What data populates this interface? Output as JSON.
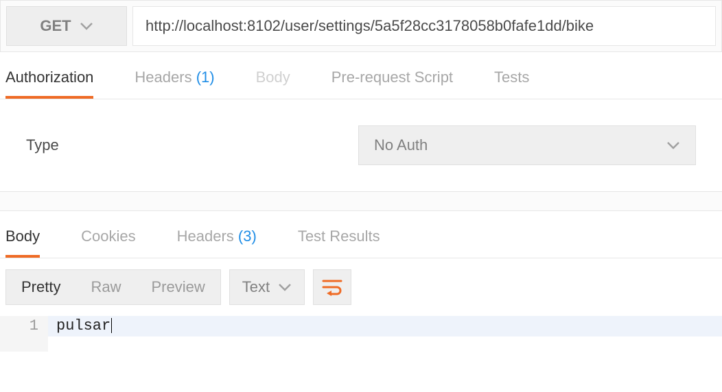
{
  "request": {
    "method": "GET",
    "url": "http://localhost:8102/user/settings/5a5f28cc3178058b0fafe1dd/bike"
  },
  "request_tabs": {
    "authorization": "Authorization",
    "headers_label": "Headers",
    "headers_count": "(1)",
    "body": "Body",
    "pre_request": "Pre-request Script",
    "tests": "Tests"
  },
  "auth": {
    "type_label": "Type",
    "selected": "No Auth"
  },
  "response_tabs": {
    "body": "Body",
    "cookies": "Cookies",
    "headers_label": "Headers",
    "headers_count": "(3)",
    "test_results": "Test Results"
  },
  "view_modes": {
    "pretty": "Pretty",
    "raw": "Raw",
    "preview": "Preview"
  },
  "format_select": "Text",
  "response_body": {
    "line_number": "1",
    "content": "pulsar"
  }
}
